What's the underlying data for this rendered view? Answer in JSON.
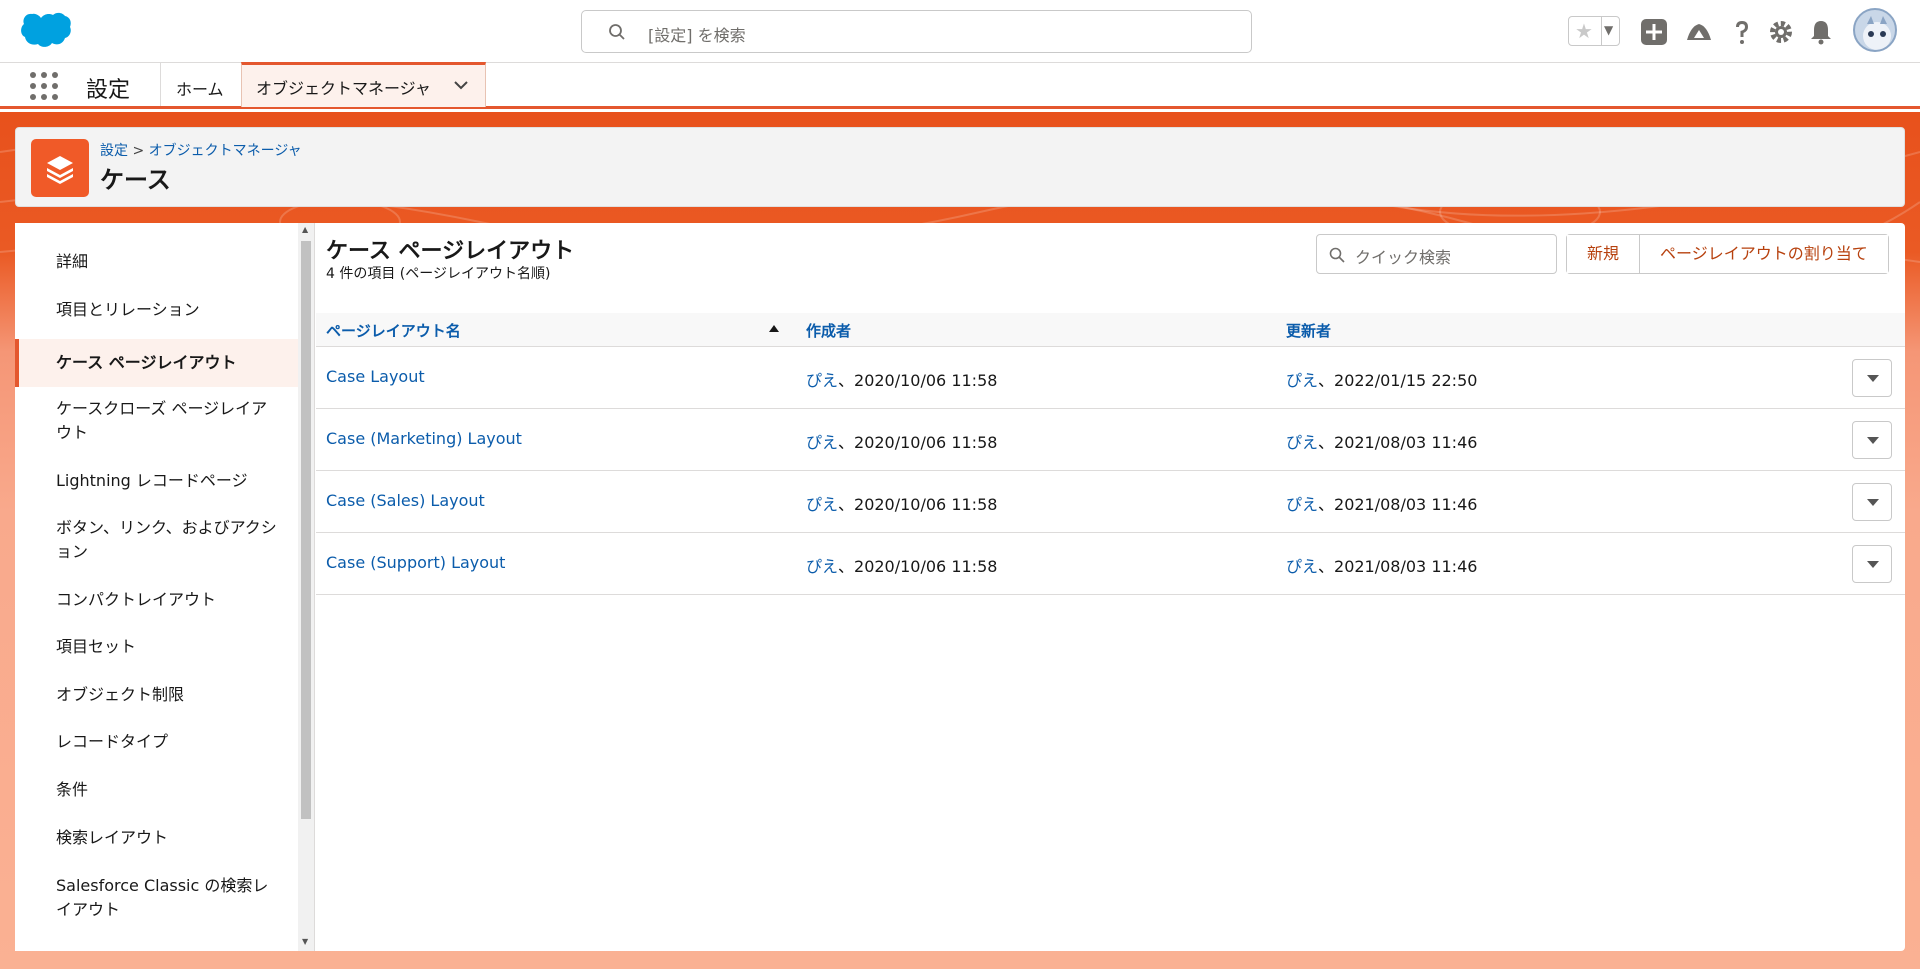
{
  "global_header": {
    "search_placeholder": "[設定] を検索",
    "icons": [
      "favorites-star-icon",
      "add-icon",
      "trailhead-icon",
      "help-icon",
      "settings-gear-icon",
      "notifications-bell-icon",
      "user-avatar"
    ]
  },
  "context_bar": {
    "app_name": "設定",
    "tabs": [
      {
        "label": "ホーム"
      },
      {
        "label": "オブジェクトマネージャ"
      }
    ]
  },
  "page_header": {
    "breadcrumb": [
      "設定",
      "オブジェクトマネージャ"
    ],
    "breadcrumb_sep": ">",
    "title": "ケース",
    "icon": "stacked-layers-icon"
  },
  "sidebar": {
    "items": [
      {
        "label": "詳細"
      },
      {
        "label": "項目とリレーション"
      },
      {
        "label": "ケース ページレイアウト"
      },
      {
        "label": "ケースクローズ ページレイアウト"
      },
      {
        "label": "Lightning レコードページ"
      },
      {
        "label": "ボタン、リンク、およびアクション"
      },
      {
        "label": "コンパクトレイアウト"
      },
      {
        "label": "項目セット"
      },
      {
        "label": "オブジェクト制限"
      },
      {
        "label": "レコードタイプ"
      },
      {
        "label": "条件"
      },
      {
        "label": "検索レイアウト"
      },
      {
        "label": "Salesforce Classic の検索レイアウト"
      }
    ],
    "active_index": 2
  },
  "content": {
    "title": "ケース ページレイアウト",
    "subtitle": "4 件の項目 (ページレイアウト名順)",
    "quick_search_placeholder": "クイック検索",
    "buttons": {
      "new": "新規",
      "assign": "ページレイアウトの割り当て"
    },
    "table": {
      "columns": [
        "ページレイアウト名",
        "作成者",
        "更新者"
      ],
      "rows": [
        {
          "name": "Case Layout",
          "created_by": "ぴえ",
          "created_at": "、2020/10/06 11:58",
          "updated_by": "ぴえ",
          "updated_at": "、2022/01/15 22:50"
        },
        {
          "name": "Case (Marketing) Layout",
          "created_by": "ぴえ",
          "created_at": "、2020/10/06 11:58",
          "updated_by": "ぴえ",
          "updated_at": "、2021/08/03 11:46"
        },
        {
          "name": "Case (Sales) Layout",
          "created_by": "ぴえ",
          "created_at": "、2020/10/06 11:58",
          "updated_by": "ぴえ",
          "updated_at": "、2021/08/03 11:46"
        },
        {
          "name": "Case (Support) Layout",
          "created_by": "ぴえ",
          "created_at": "、2020/10/06 11:58",
          "updated_by": "ぴえ",
          "updated_at": "、2021/08/03 11:46"
        }
      ]
    }
  },
  "colors": {
    "brand_orange": "#e4572e",
    "link_blue": "#0b5cab",
    "salesforce_blue": "#00a1e0"
  }
}
